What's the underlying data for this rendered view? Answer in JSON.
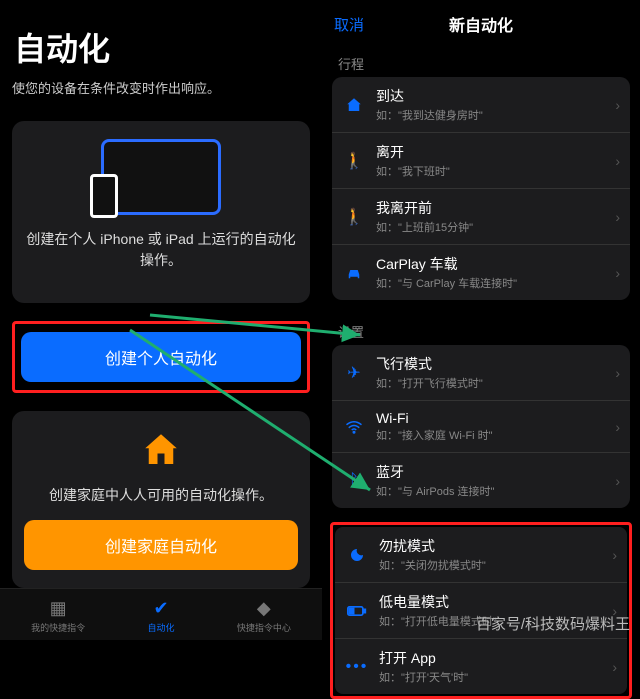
{
  "left": {
    "title": "自动化",
    "subtitle": "使您的设备在条件改变时作出响应。",
    "personal": {
      "text": "创建在个人 iPhone 或 iPad 上运行的自动化操作。",
      "button": "创建个人自动化"
    },
    "home": {
      "text": "创建家庭中人人可用的自动化操作。",
      "button": "创建家庭自动化"
    },
    "tabs": {
      "shortcuts": "我的快捷指令",
      "automation": "自动化",
      "gallery": "快捷指令中心"
    }
  },
  "right": {
    "cancel": "取消",
    "title": "新自动化",
    "section_travel": "行程",
    "section_settings": "设置",
    "travel": [
      {
        "title": "到达",
        "sub": "如：\"我到达健身房时\""
      },
      {
        "title": "离开",
        "sub": "如：\"我下班时\""
      },
      {
        "title": "我离开前",
        "sub": "如：\"上班前15分钟\""
      },
      {
        "title": "CarPlay 车载",
        "sub": "如：\"与 CarPlay 车载连接时\""
      }
    ],
    "settings1": [
      {
        "title": "飞行模式",
        "sub": "如：\"打开飞行模式时\""
      },
      {
        "title": "Wi-Fi",
        "sub": "如：\"接入家庭 Wi-Fi 时\""
      },
      {
        "title": "蓝牙",
        "sub": "如：\"与 AirPods 连接时\""
      }
    ],
    "settings2": [
      {
        "title": "勿扰模式",
        "sub": "如：\"关闭勿扰模式时\""
      },
      {
        "title": "低电量模式",
        "sub": "如：\"打开低电量模式时\""
      },
      {
        "title": "打开 App",
        "sub": "如：\"打开'天气'时\""
      }
    ]
  },
  "watermark": "百家号/科技数码爆料王"
}
